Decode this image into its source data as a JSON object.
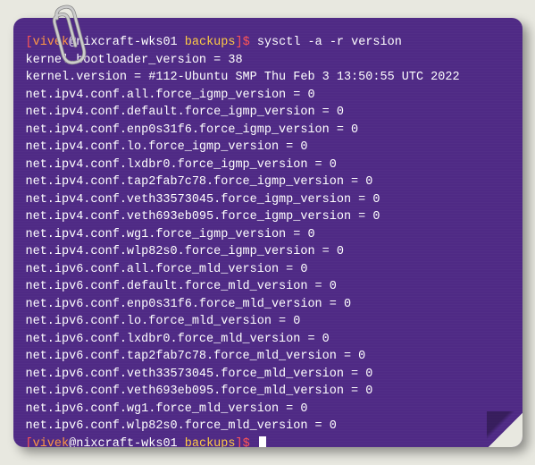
{
  "prompt": {
    "bracket_open": "[",
    "user": "vivek",
    "at": "@",
    "host": "nixcraft-wks01",
    "dir": "backups",
    "bracket_close": "]",
    "dollar": "$"
  },
  "command": "sysctl -a -r version",
  "output": [
    "kernel.bootloader_version = 38",
    "kernel.version = #112-Ubuntu SMP Thu Feb 3 13:50:55 UTC 2022",
    "net.ipv4.conf.all.force_igmp_version = 0",
    "net.ipv4.conf.default.force_igmp_version = 0",
    "net.ipv4.conf.enp0s31f6.force_igmp_version = 0",
    "net.ipv4.conf.lo.force_igmp_version = 0",
    "net.ipv4.conf.lxdbr0.force_igmp_version = 0",
    "net.ipv4.conf.tap2fab7c78.force_igmp_version = 0",
    "net.ipv4.conf.veth33573045.force_igmp_version = 0",
    "net.ipv4.conf.veth693eb095.force_igmp_version = 0",
    "net.ipv4.conf.wg1.force_igmp_version = 0",
    "net.ipv4.conf.wlp82s0.force_igmp_version = 0",
    "net.ipv6.conf.all.force_mld_version = 0",
    "net.ipv6.conf.default.force_mld_version = 0",
    "net.ipv6.conf.enp0s31f6.force_mld_version = 0",
    "net.ipv6.conf.lo.force_mld_version = 0",
    "net.ipv6.conf.lxdbr0.force_mld_version = 0",
    "net.ipv6.conf.tap2fab7c78.force_mld_version = 0",
    "net.ipv6.conf.veth33573045.force_mld_version = 0",
    "net.ipv6.conf.veth693eb095.force_mld_version = 0",
    "net.ipv6.conf.wg1.force_mld_version = 0",
    "net.ipv6.conf.wlp82s0.force_mld_version = 0"
  ]
}
